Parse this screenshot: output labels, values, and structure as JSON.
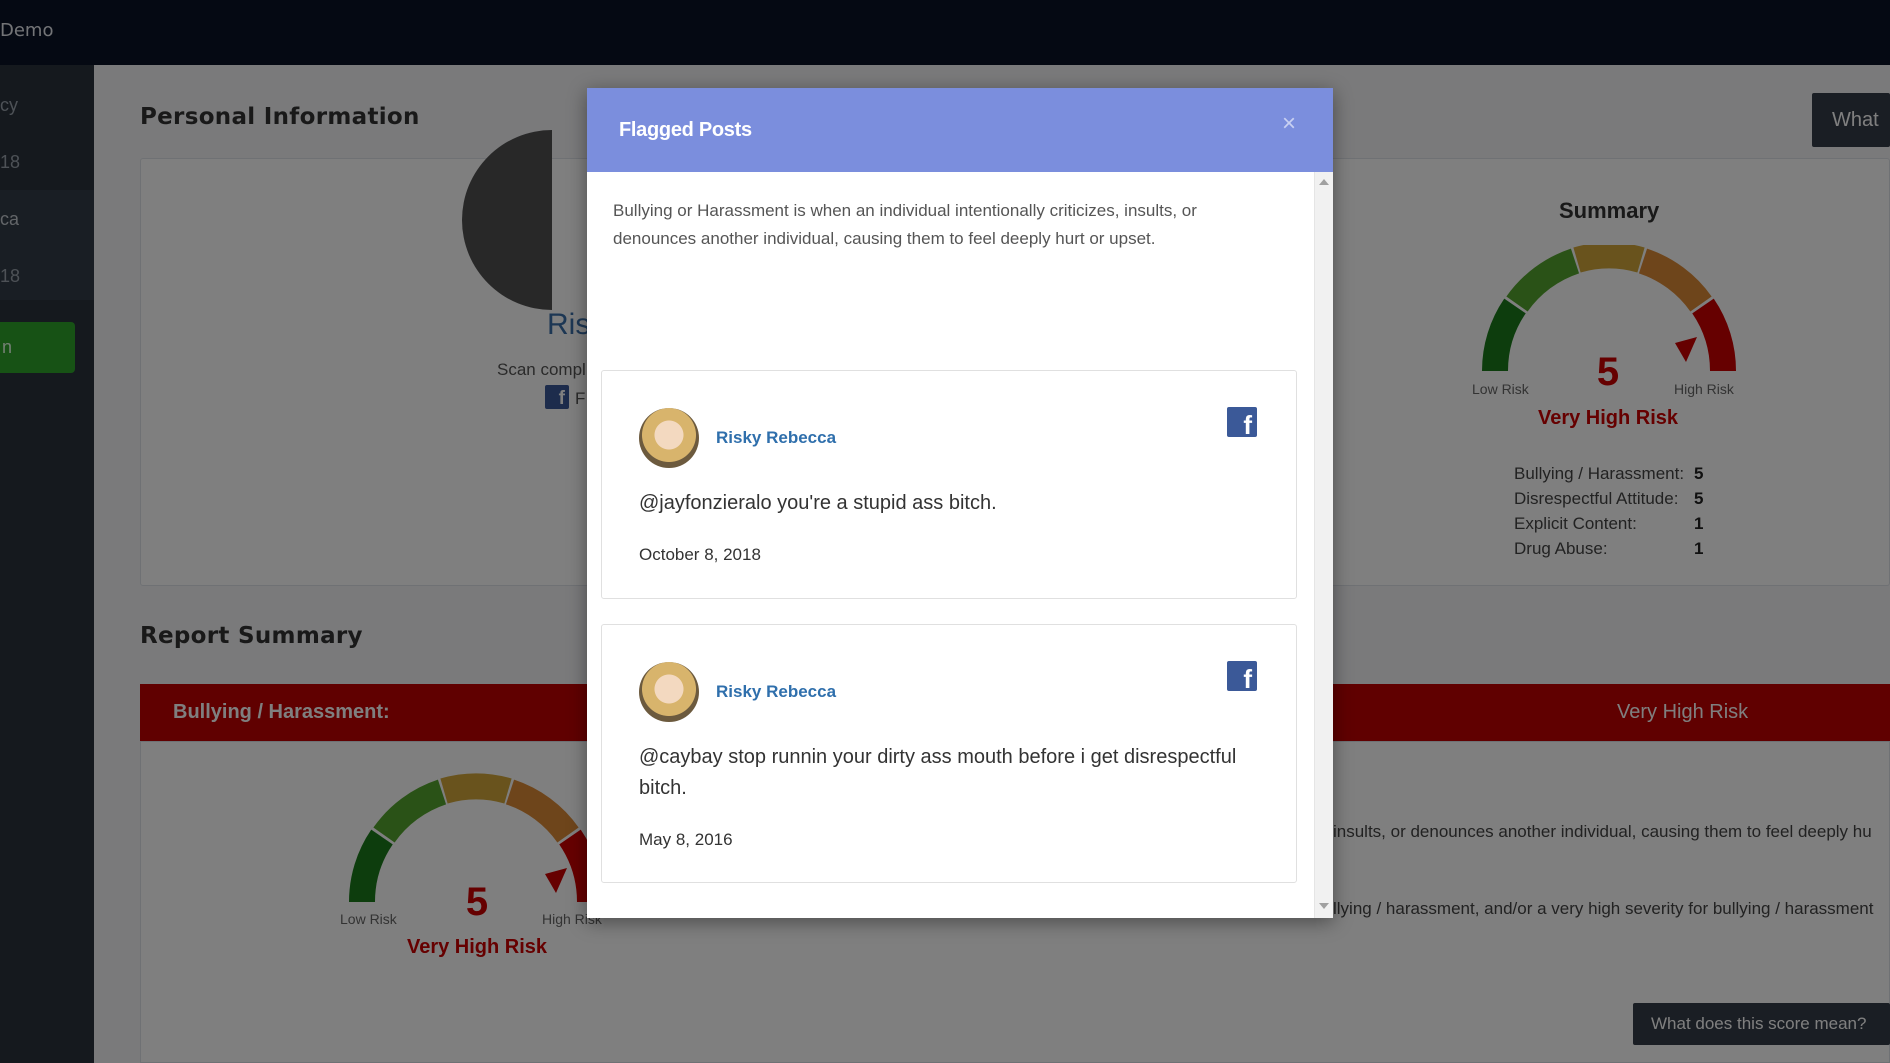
{
  "topbar": {
    "brand": "Demo"
  },
  "sidebar": {
    "items": [
      {
        "label": "cy"
      },
      {
        "label": "18"
      },
      {
        "label": "ca"
      },
      {
        "label": "18"
      }
    ],
    "action_label": "n"
  },
  "personal": {
    "title": "Personal Information",
    "name": "Ris",
    "scan": "Scan compl",
    "platform_partial": "F",
    "what_button": "What d"
  },
  "summary": {
    "title": "Summary",
    "score": "5",
    "low_label": "Low Risk",
    "high_label": "High Risk",
    "risk_level": "Very High Risk",
    "stats": [
      {
        "label": "Bullying / Harassment:",
        "value": "5"
      },
      {
        "label": "Disrespectful Attitude:",
        "value": "5"
      },
      {
        "label": "Explicit Content:",
        "value": "1"
      },
      {
        "label": "Drug Abuse:",
        "value": "1"
      }
    ]
  },
  "report": {
    "title": "Report Summary",
    "category": "Bullying / Harassment:",
    "risk": "Very High Risk",
    "score": "5",
    "low_label": "Low Risk",
    "high_label": "High Risk",
    "risk_level": "Very High Risk",
    "desc1": "insults, or denounces another individual, causing them to feel deeply hu",
    "desc2": "llying / harassment, and/or a very high severity for bullying / harassment",
    "score_button": "What does this score mean?"
  },
  "colors": {
    "risk_red": "#c00000",
    "modal_header": "#7b8edd",
    "facebook": "#3b5998",
    "accent_green": "#2ea52b"
  },
  "modal": {
    "title": "Flagged Posts",
    "close_icon": "close-icon",
    "intro": "Bullying or Harassment is when an individual intentionally criticizes, insults, or denounces another individual, causing them to feel deeply hurt or upset.",
    "posts": [
      {
        "user": "Risky Rebecca",
        "platform_icon": "facebook-icon",
        "text": "@jayfonzieralo you're a stupid ass bitch.",
        "date": "October 8, 2018"
      },
      {
        "user": "Risky Rebecca",
        "platform_icon": "facebook-icon",
        "text": "@caybay stop runnin your dirty ass mouth before i get disrespectful bitch.",
        "date": "May 8, 2016"
      }
    ]
  }
}
